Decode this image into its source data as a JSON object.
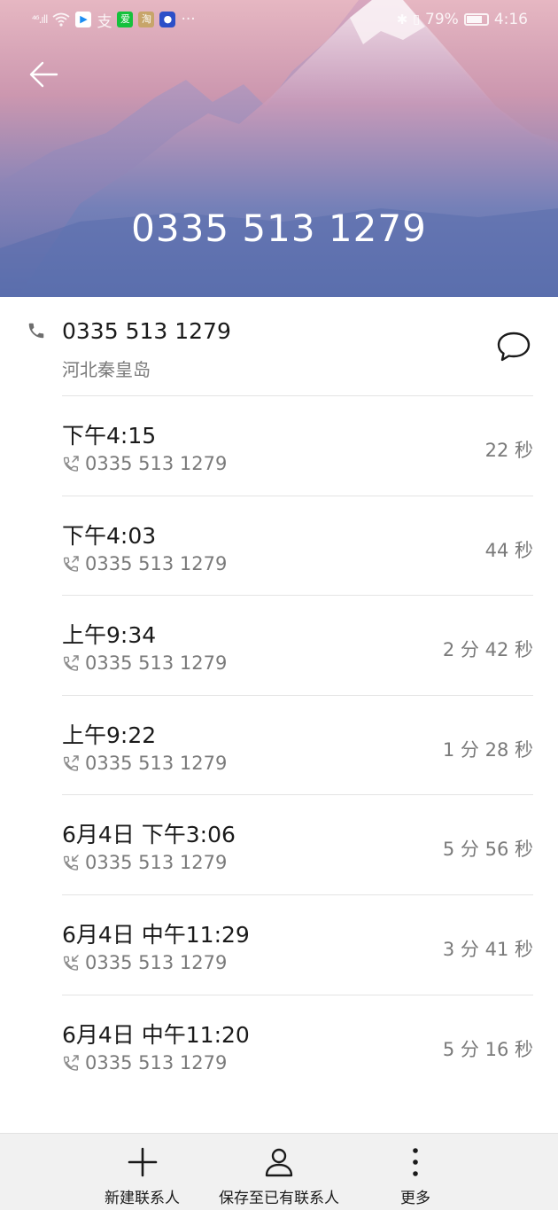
{
  "status_bar": {
    "signal": "⁴⁶.ıll",
    "app_icons": [
      "youku-icon",
      "alipay-icon",
      "iqiyi-icon",
      "taobao-icon",
      "o-app-icon"
    ],
    "more": "···",
    "battery_percent": "79%",
    "battery_level": 0.79,
    "time": "4:16"
  },
  "header": {
    "number": "0335 513 1279",
    "colors": {
      "sky_top": "#e6b7c2",
      "mountain_low": "#5a6fae"
    }
  },
  "contact": {
    "number": "0335 513 1279",
    "location": "河北秦皇岛"
  },
  "calls": [
    {
      "time": "下午4:15",
      "number": "0335 513 1279",
      "duration": "22 秒",
      "direction": "outgoing"
    },
    {
      "time": "下午4:03",
      "number": "0335 513 1279",
      "duration": "44 秒",
      "direction": "outgoing"
    },
    {
      "time": "上午9:34",
      "number": "0335 513 1279",
      "duration": "2 分 42 秒",
      "direction": "outgoing"
    },
    {
      "time": "上午9:22",
      "number": "0335 513 1279",
      "duration": "1 分 28 秒",
      "direction": "outgoing"
    },
    {
      "time": "6月4日 下午3:06",
      "number": "0335 513 1279",
      "duration": "5 分 56 秒",
      "direction": "incoming"
    },
    {
      "time": "6月4日 中午11:29",
      "number": "0335 513 1279",
      "duration": "3 分 41 秒",
      "direction": "incoming"
    },
    {
      "time": "6月4日 中午11:20",
      "number": "0335 513 1279",
      "duration": "5 分 16 秒",
      "direction": "outgoing"
    }
  ],
  "bottom_bar": {
    "new_contact": "新建联系人",
    "save_existing": "保存至已有联系人",
    "more": "更多"
  }
}
